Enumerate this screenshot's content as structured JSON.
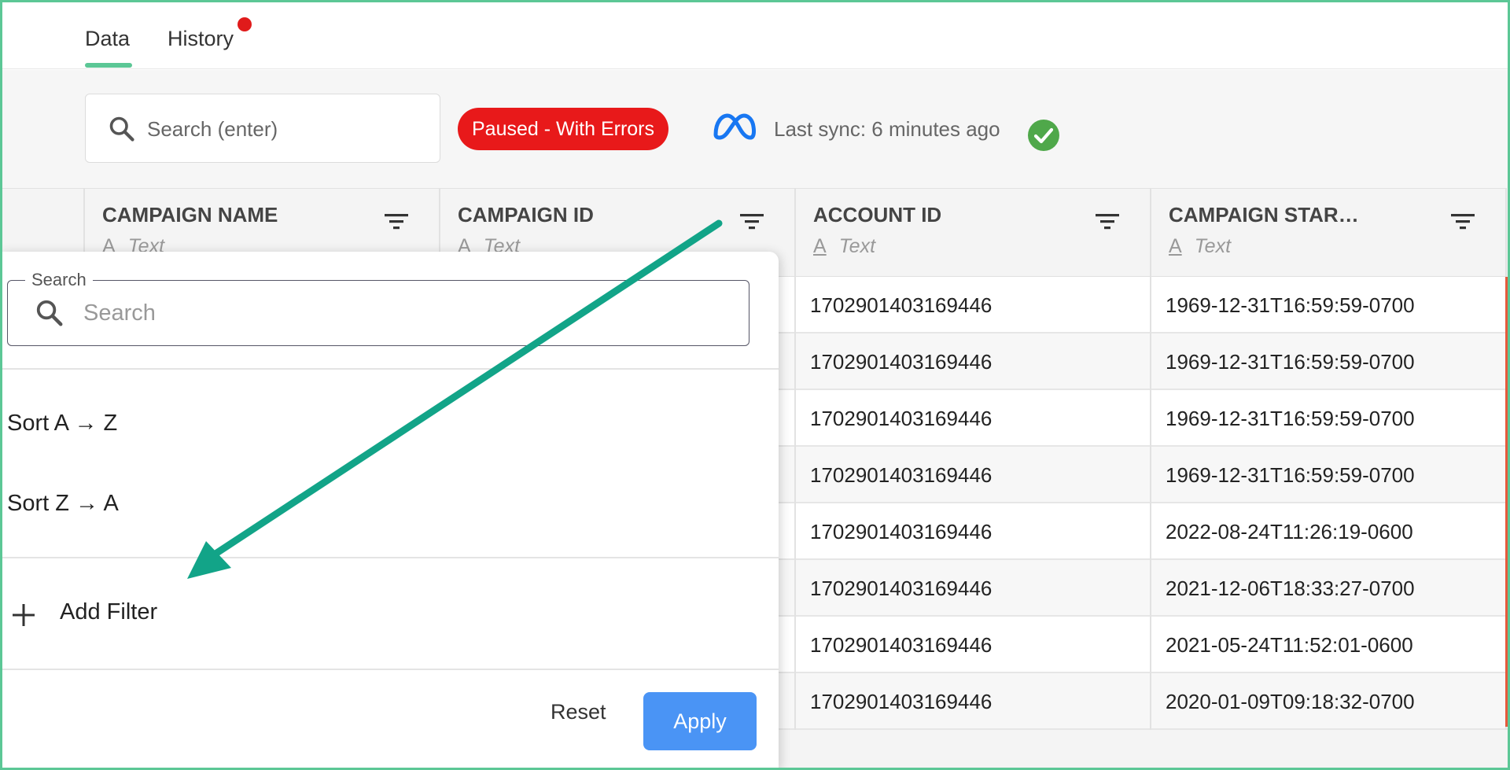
{
  "tabs": [
    {
      "label": "Data",
      "active": true
    },
    {
      "label": "History",
      "has_notification": true
    }
  ],
  "toolbar": {
    "search_placeholder": "Search (enter)",
    "status_badge": "Paused - With Errors",
    "last_sync": "Last sync: 6 minutes ago"
  },
  "columns": [
    {
      "title": "CAMPAIGN NAME",
      "type": "Text"
    },
    {
      "title": "CAMPAIGN ID",
      "type": "Text"
    },
    {
      "title": "ACCOUNT ID",
      "type": "Text"
    },
    {
      "title": "CAMPAIGN STAR…",
      "type": "Text"
    }
  ],
  "rows": [
    {
      "account_id": "1702901403169446",
      "campaign_start": "1969-12-31T16:59:59-0700"
    },
    {
      "account_id": "1702901403169446",
      "campaign_start": "1969-12-31T16:59:59-0700"
    },
    {
      "account_id": "1702901403169446",
      "campaign_start": "1969-12-31T16:59:59-0700"
    },
    {
      "account_id": "1702901403169446",
      "campaign_start": "1969-12-31T16:59:59-0700"
    },
    {
      "account_id": "1702901403169446",
      "campaign_start": "2022-08-24T11:26:19-0600"
    },
    {
      "account_id": "1702901403169446",
      "campaign_start": "2021-12-06T18:33:27-0700"
    },
    {
      "account_id": "1702901403169446",
      "campaign_start": "2021-05-24T11:52:01-0600"
    },
    {
      "account_id": "1702901403169446",
      "campaign_start": "2020-01-09T09:18:32-0700"
    }
  ],
  "filter_panel": {
    "search_label": "Search",
    "search_placeholder": "Search",
    "sort_asc": "Sort A → Z",
    "sort_desc": "Sort Z → A",
    "add_filter": "Add Filter",
    "reset": "Reset",
    "apply": "Apply"
  },
  "colors": {
    "accent_green": "#5cc796",
    "error_red": "#e8191a",
    "apply_blue": "#4a94f5",
    "annotation_arrow": "#12a488"
  },
  "icons": [
    "search-icon",
    "meta-logo-icon",
    "check-circle-icon",
    "filter-icon",
    "plus-icon"
  ]
}
